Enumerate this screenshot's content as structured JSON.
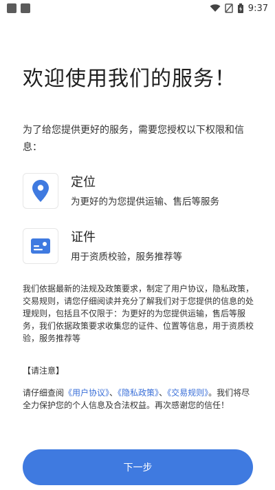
{
  "status_bar": {
    "time": "9:37"
  },
  "title": "欢迎使用我们的服务！",
  "intro": "为了给您提供更好的服务，需要您授权以下权限和信息：",
  "permissions": [
    {
      "name": "定位",
      "desc": "为更好的为您提供运输、售后等服务",
      "icon": "location-pin-icon"
    },
    {
      "name": "证件",
      "desc": "用于资质校验，服务推荐等",
      "icon": "id-card-icon"
    }
  ],
  "policy_text": "我们依据最新的法规及政策要求，制定了用户协议，隐私政策，交易规则，请您仔细阅读并充分了解我们对于您提供的信息的处理规则，包括且不仅限于：为更好的为您提供运输，售后等服务，我们依据政策要求收集您的证件、位置等信息，用于资质校验，服务推荐等",
  "note": {
    "title": "【请注意】",
    "prefix": "请仔细查阅",
    "link_user_agreement": "《用户协议》",
    "sep1": "、",
    "link_privacy": "《隐私政策》",
    "sep2": "、",
    "link_trade_rules": "《交易规则》",
    "suffix": "。我们将尽全力保护您的个人信息及合法权益。再次感谢您的信任！"
  },
  "next_button": "下一步",
  "colors": {
    "accent": "#3f7ae0",
    "link": "#3a6fd8"
  }
}
